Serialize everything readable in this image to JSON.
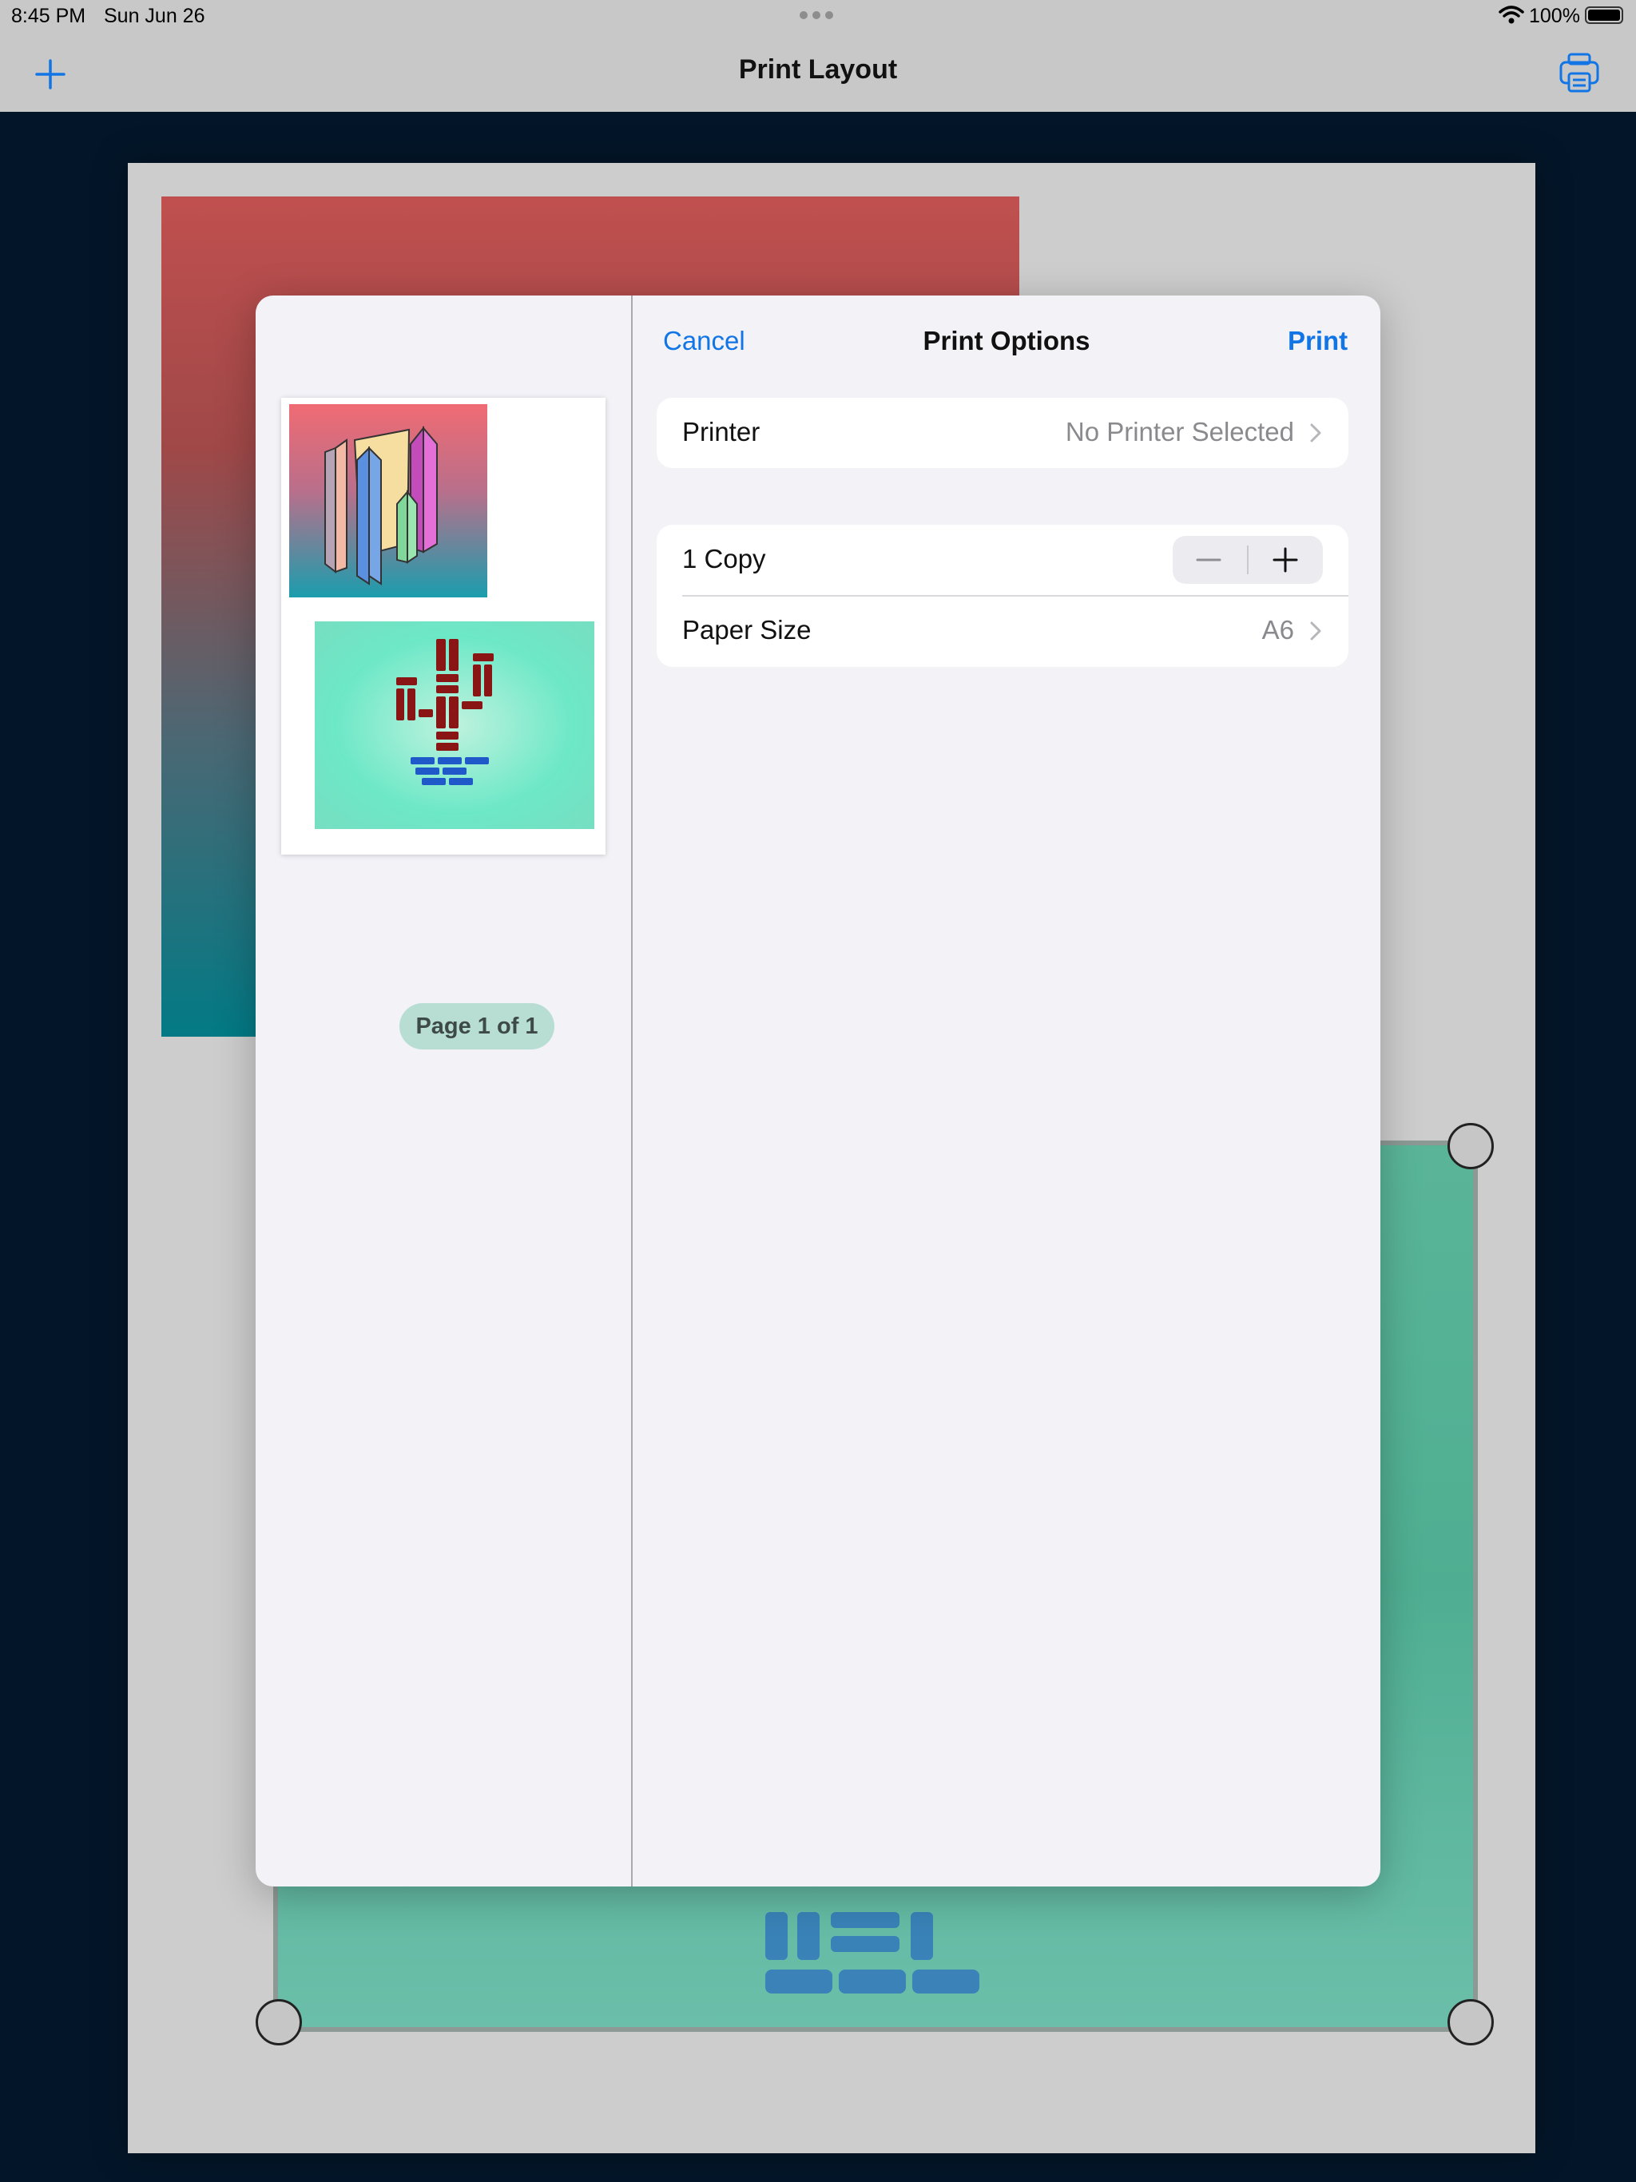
{
  "status": {
    "time": "8:45 PM",
    "date": "Sun Jun 26",
    "battery": "100%"
  },
  "nav": {
    "title": "Print Layout",
    "add_icon": "plus-icon",
    "print_icon": "printer-icon"
  },
  "sheet": {
    "cancel": "Cancel",
    "title": "Print Options",
    "print": "Print",
    "printer": {
      "label": "Printer",
      "value": "No Printer Selected"
    },
    "copies": {
      "label": "1 Copy"
    },
    "paper_size": {
      "label": "Paper Size",
      "value": "A6"
    },
    "preview_badge": "Page 1 of 1"
  },
  "colors": {
    "accent": "#1275e6",
    "canvas_bg": "#031629"
  }
}
